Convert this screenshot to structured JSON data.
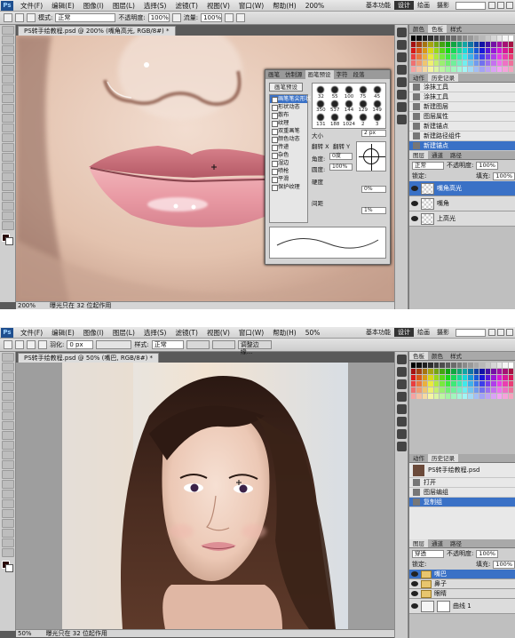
{
  "shot1": {
    "menu": [
      "文件(F)",
      "编辑(E)",
      "图像(I)",
      "图层(L)",
      "选择(S)",
      "滤镜(T)",
      "视图(V)",
      "窗口(W)",
      "帮助(H)"
    ],
    "zoom_label": "200%",
    "workspaces": [
      "基本功能",
      "设计",
      "绘画",
      "摄影"
    ],
    "active_workspace": "设计",
    "options": {
      "mode_label": "模式:",
      "mode_value": "正常",
      "opacity_label": "不透明度:",
      "opacity_value": "100%",
      "flow_label": "流量:",
      "flow_value": "100%"
    },
    "doc_tab": "PS转手绘教程.psd @ 200% (嘴角高光, RGB/8#) *",
    "status_zoom": "200%",
    "status_text": "曝光只在 32 位起作用",
    "panel_tabs": [
      "颜色",
      "色板",
      "样式"
    ],
    "history_tabs": [
      "动作",
      "历史记录"
    ],
    "history": [
      "涂抹工具",
      "涂抹工具",
      "新建图层",
      "图层属性",
      "新建锚点",
      "新建路径组件",
      "新建锚点"
    ],
    "layers_tabs": [
      "图层",
      "通道",
      "路径"
    ],
    "layers_blend": "正常",
    "layers_opacity_label": "不透明度:",
    "layers_opacity": "100%",
    "layers_lock_label": "锁定:",
    "layers_fill_label": "填充:",
    "layers_fill": "100%",
    "layers": [
      {
        "name": "嘴角高光",
        "selected": true
      },
      {
        "name": "嘴角",
        "selected": false
      },
      {
        "name": "上高光",
        "selected": false
      }
    ],
    "brushes": {
      "tabs": [
        "画笔",
        "仿制源",
        "画笔预设",
        "字符",
        "段落"
      ],
      "preset_button": "画笔预设",
      "list": [
        {
          "label": "画笔笔尖形状",
          "selected": true
        },
        {
          "label": "形状动态",
          "selected": false
        },
        {
          "label": "散布",
          "selected": false
        },
        {
          "label": "纹理",
          "selected": false
        },
        {
          "label": "双重画笔",
          "selected": false
        },
        {
          "label": "颜色动态",
          "selected": false
        },
        {
          "label": "传递",
          "selected": false
        },
        {
          "label": "杂色",
          "selected": false
        },
        {
          "label": "湿边",
          "selected": false
        },
        {
          "label": "喷枪",
          "selected": false
        },
        {
          "label": "平滑",
          "selected": false
        },
        {
          "label": "保护纹理",
          "selected": false
        }
      ],
      "tip_sizes": [
        "32",
        "55",
        "100",
        "75",
        "45",
        "350",
        "537",
        "144",
        "129",
        "149",
        "131",
        "188",
        "1024",
        "2",
        "3"
      ],
      "size_label": "大小",
      "size_value": "2 px",
      "flipx_label": "翻转 X",
      "flipy_label": "翻转 Y",
      "angle_label": "角度:",
      "angle_value": "0度",
      "roundness_label": "圆度:",
      "roundness_value": "100%",
      "hardness_label": "硬度",
      "hardness_value": "0%",
      "spacing_label": "间距",
      "spacing_value": "1%"
    }
  },
  "shot2": {
    "menu": [
      "文件(F)",
      "编辑(E)",
      "图像(I)",
      "图层(L)",
      "选择(S)",
      "滤镜(T)",
      "视图(V)",
      "窗口(W)",
      "帮助(H)"
    ],
    "zoom_label": "50%",
    "workspaces": [
      "基本功能",
      "设计",
      "绘画",
      "摄影"
    ],
    "active_workspace": "设计",
    "options": {
      "feather_label": "羽化:",
      "feather_value": "0 px",
      "style_label": "样式:",
      "style_value": "正常",
      "refine_label": "调整边缘..."
    },
    "doc_tab": "PS转手绘教程.psd @ 50% (嘴巴, RGB/8#) *",
    "status_zoom": "50%",
    "status_text": "曝光只在 32 位起作用",
    "panel_tabs": [
      "色板",
      "颜色",
      "样式"
    ],
    "history_tabs": [
      "动作",
      "历史记录"
    ],
    "history_doc": "PS转手绘教程.psd",
    "history": [
      {
        "label": "打开",
        "selected": false
      },
      {
        "label": "图层编组",
        "selected": false
      },
      {
        "label": "复制组",
        "selected": true
      }
    ],
    "layers_tabs": [
      "图层",
      "通道",
      "路径"
    ],
    "layers_blend": "穿透",
    "layers_opacity_label": "不透明度:",
    "layers_opacity": "100%",
    "layers_lock_label": "锁定:",
    "layers_fill_label": "填充:",
    "layers_fill": "100%",
    "layers": [
      {
        "name": "嘴巴",
        "selected": true
      },
      {
        "name": "鼻子",
        "selected": false
      },
      {
        "name": "眼睛",
        "selected": false
      }
    ],
    "curve_layer_name": "曲线 1"
  },
  "colors": {
    "accent": "#3a71c6",
    "lip": "#e79aa3",
    "skin": "#e9c9b4",
    "hair": "#3b241b"
  }
}
